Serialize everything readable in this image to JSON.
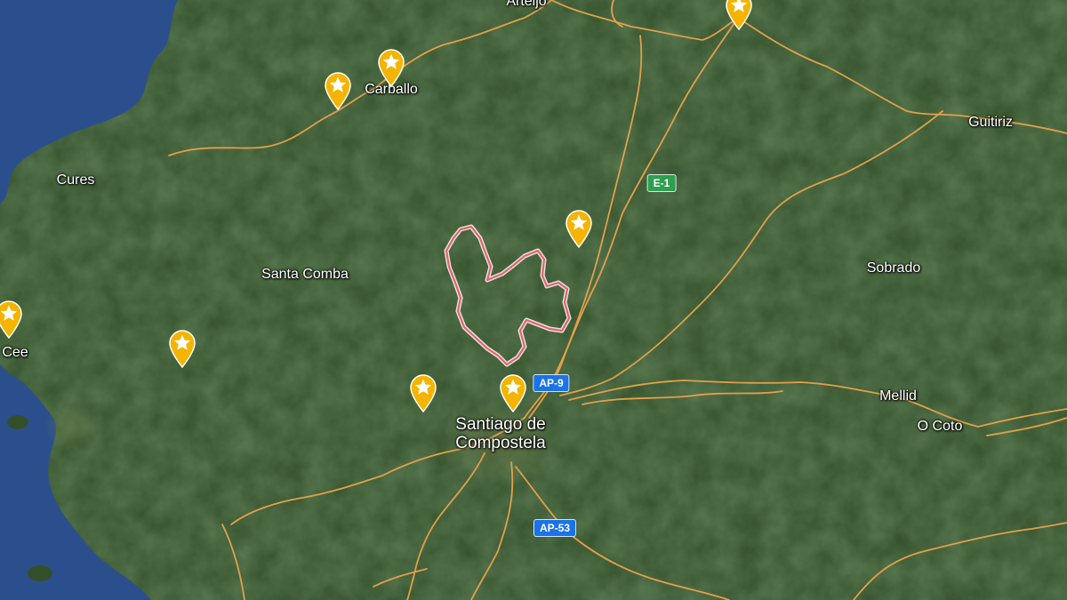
{
  "map": {
    "colors": {
      "sea": "#2b4f8c",
      "land": "#33502a",
      "road": "#e2a04a",
      "boundary": "#e8606a",
      "pin": "#f4b400",
      "shield_blue": "#1a73e8",
      "shield_green": "#2e9e4f"
    },
    "places": {
      "arteijo": "Arteijo",
      "carballo": "Carballo",
      "guitiriz": "Guitiriz",
      "cures": "Cures",
      "santa_comba": "Santa Comba",
      "sobrado": "Sobrado",
      "cee": "Cee",
      "mellid": "Mellid",
      "o_coto": "O Coto",
      "santiago": "Santiago de Compostela"
    },
    "road_shields": {
      "e1": "E-1",
      "ap9": "AP-9",
      "ap53": "AP-53"
    },
    "markers": [
      {
        "name": "marker-north",
        "icon": "star-icon"
      },
      {
        "name": "marker-carballo-1",
        "icon": "star-icon"
      },
      {
        "name": "marker-carballo-2",
        "icon": "star-icon"
      },
      {
        "name": "marker-east",
        "icon": "star-icon"
      },
      {
        "name": "marker-cee",
        "icon": "star-icon"
      },
      {
        "name": "marker-west",
        "icon": "star-icon"
      },
      {
        "name": "marker-santiago-west",
        "icon": "star-icon"
      },
      {
        "name": "marker-santiago",
        "icon": "star-icon"
      }
    ]
  }
}
